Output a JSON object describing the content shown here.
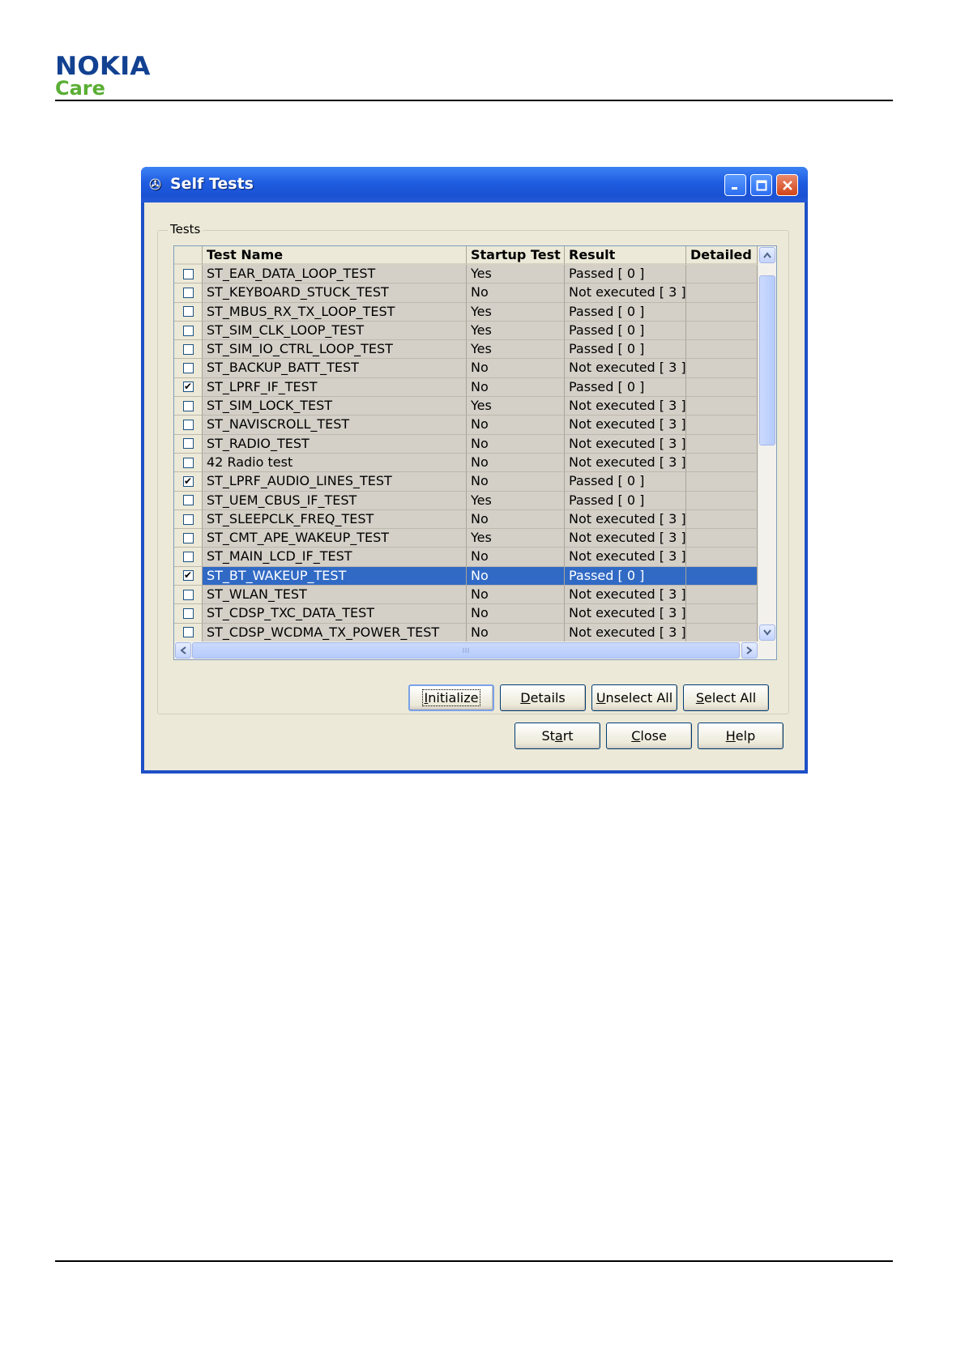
{
  "brand": {
    "name": "NOKIA",
    "sub": "Care"
  },
  "window": {
    "title": "Self Tests",
    "icon": "wrench-tools-icon"
  },
  "group": {
    "label": "Tests"
  },
  "table": {
    "columns": [
      "",
      "Test Name",
      "Startup Test",
      "Result",
      "Detailed"
    ],
    "rows": [
      {
        "checked": false,
        "name": "ST_EAR_DATA_LOOP_TEST",
        "startup": "Yes",
        "result": "Passed  [ 0 ]",
        "detailed": ""
      },
      {
        "checked": false,
        "name": "ST_KEYBOARD_STUCK_TEST",
        "startup": "No",
        "result": "Not executed  [ 3 ]",
        "detailed": ""
      },
      {
        "checked": false,
        "name": "ST_MBUS_RX_TX_LOOP_TEST",
        "startup": "Yes",
        "result": "Passed  [ 0 ]",
        "detailed": ""
      },
      {
        "checked": false,
        "name": "ST_SIM_CLK_LOOP_TEST",
        "startup": "Yes",
        "result": "Passed  [ 0 ]",
        "detailed": ""
      },
      {
        "checked": false,
        "name": "ST_SIM_IO_CTRL_LOOP_TEST",
        "startup": "Yes",
        "result": "Passed  [ 0 ]",
        "detailed": ""
      },
      {
        "checked": false,
        "name": "ST_BACKUP_BATT_TEST",
        "startup": "No",
        "result": "Not executed  [ 3 ]",
        "detailed": ""
      },
      {
        "checked": true,
        "name": "ST_LPRF_IF_TEST",
        "startup": "No",
        "result": "Passed  [ 0 ]",
        "detailed": ""
      },
      {
        "checked": false,
        "name": "ST_SIM_LOCK_TEST",
        "startup": "Yes",
        "result": "Not executed  [ 3 ]",
        "detailed": ""
      },
      {
        "checked": false,
        "name": "ST_NAVISCROLL_TEST",
        "startup": "No",
        "result": "Not executed  [ 3 ]",
        "detailed": ""
      },
      {
        "checked": false,
        "name": "ST_RADIO_TEST",
        "startup": "No",
        "result": "Not executed  [ 3 ]",
        "detailed": ""
      },
      {
        "checked": false,
        "name": "42 Radio test",
        "startup": "No",
        "result": "Not executed  [ 3 ]",
        "detailed": ""
      },
      {
        "checked": true,
        "name": "ST_LPRF_AUDIO_LINES_TEST",
        "startup": "No",
        "result": "Passed  [ 0 ]",
        "detailed": ""
      },
      {
        "checked": false,
        "name": "ST_UEM_CBUS_IF_TEST",
        "startup": "Yes",
        "result": "Passed  [ 0 ]",
        "detailed": ""
      },
      {
        "checked": false,
        "name": "ST_SLEEPCLK_FREQ_TEST",
        "startup": "No",
        "result": "Not executed  [ 3 ]",
        "detailed": ""
      },
      {
        "checked": false,
        "name": "ST_CMT_APE_WAKEUP_TEST",
        "startup": "Yes",
        "result": "Not executed  [ 3 ]",
        "detailed": ""
      },
      {
        "checked": false,
        "name": "ST_MAIN_LCD_IF_TEST",
        "startup": "No",
        "result": "Not executed  [ 3 ]",
        "detailed": ""
      },
      {
        "checked": true,
        "selected": true,
        "name": "ST_BT_WAKEUP_TEST",
        "startup": "No",
        "result": "Passed  [ 0 ]",
        "detailed": ""
      },
      {
        "checked": false,
        "name": "ST_WLAN_TEST",
        "startup": "No",
        "result": "Not executed  [ 3 ]",
        "detailed": ""
      },
      {
        "checked": false,
        "name": "ST_CDSP_TXC_DATA_TEST",
        "startup": "No",
        "result": "Not executed  [ 3 ]",
        "detailed": ""
      },
      {
        "checked": false,
        "name": "ST_CDSP_WCDMA_TX_POWER_TEST",
        "startup": "No",
        "result": "Not executed  [ 3 ]",
        "detailed": ""
      }
    ]
  },
  "buttons": {
    "initialize": {
      "key": "I",
      "rest": "nitialize"
    },
    "details": {
      "key": "D",
      "rest": "etails"
    },
    "unselect_all": {
      "key": "U",
      "rest": "nselect All"
    },
    "select_all": {
      "key": "S",
      "rest": "elect All"
    },
    "start": {
      "pre": "St",
      "key": "a",
      "rest": "rt"
    },
    "close": {
      "key": "C",
      "rest": "lose"
    },
    "help": {
      "key": "H",
      "rest": "elp"
    }
  },
  "colors": {
    "titlebar": "#1f5ce0",
    "selection": "#316ac5",
    "nokia_blue": "#124191",
    "care_green": "#5aae34"
  }
}
